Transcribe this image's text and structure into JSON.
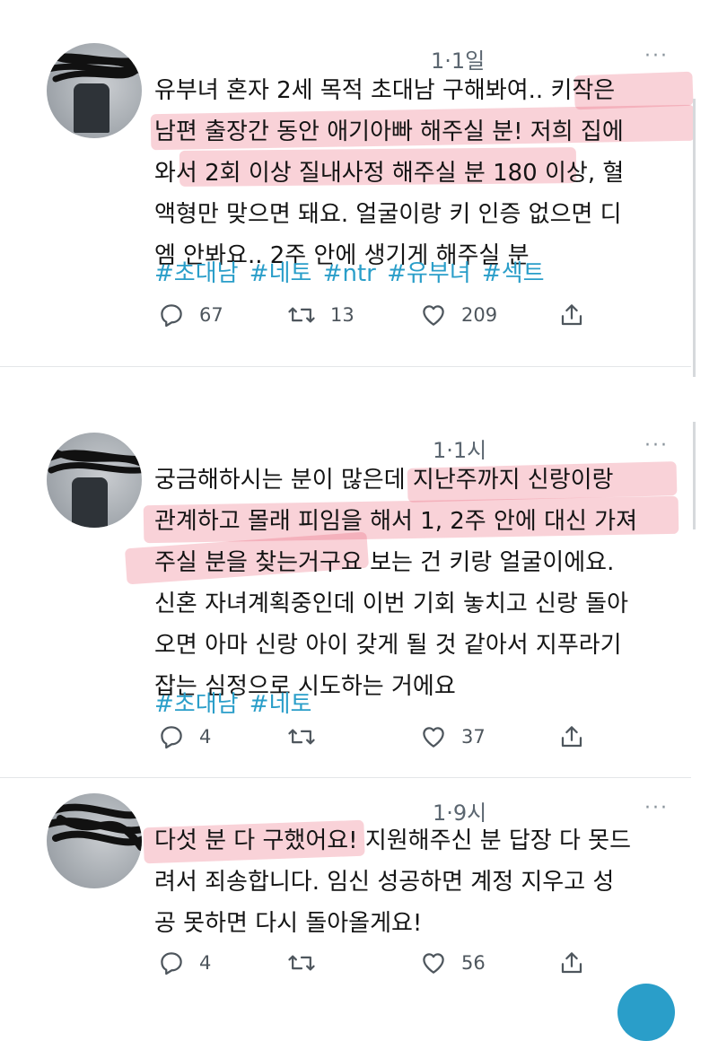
{
  "tweets": [
    {
      "time": "1·1일",
      "more": "···",
      "text": "유부녀 혼자 2세 목적 초대남 구해봐여.. 키작은\n남편 출장간 동안 애기아빠 해주실 분! 저희 집에\n와서 2회 이상 질내사정 해주실 분 180 이상, 혈\n액형만 맞으면 돼요. 얼굴이랑 키 인증 없으면 디\n엠 안봐요.. 2주 안에 생기게 해주실 분",
      "hashtags": "#초대남 #네토 #ntr #유부녀 #섹트",
      "replies": "67",
      "retweets": "13",
      "likes": "209"
    },
    {
      "time": "1·1시",
      "more": "···",
      "text": "궁금해하시는 분이 많은데 지난주까지 신랑이랑\n관계하고 몰래 피임을 해서 1, 2주 안에 대신 가져\n주실 분을 찾는거구요 보는 건 키랑 얼굴이에요.\n신혼 자녀계획중인데 이번 기회 놓치고 신랑 돌아\n오면 아마 신랑 아이 갖게 될 것 같아서 지푸라기\n잡는 심정으로 시도하는 거에요",
      "hashtags": "#초대남 #네토",
      "replies": "4",
      "retweets": "",
      "likes": "37"
    },
    {
      "time": "1·9시",
      "more": "···",
      "text": "다섯 분 다 구했어요! 지원해주신 분 답장 다 못드\n려서 죄송합니다. 임신 성공하면 계정 지우고 성\n공 못하면 다시 돌아올게요!",
      "hashtags": "",
      "replies": "4",
      "retweets": "",
      "likes": "56"
    }
  ],
  "colors": {
    "hashtag": "#2a9ec9",
    "highlight": "#eb5f73",
    "icon": "#4e565d"
  },
  "icons": [
    "reply-icon",
    "retweet-icon",
    "like-icon",
    "share-icon"
  ]
}
